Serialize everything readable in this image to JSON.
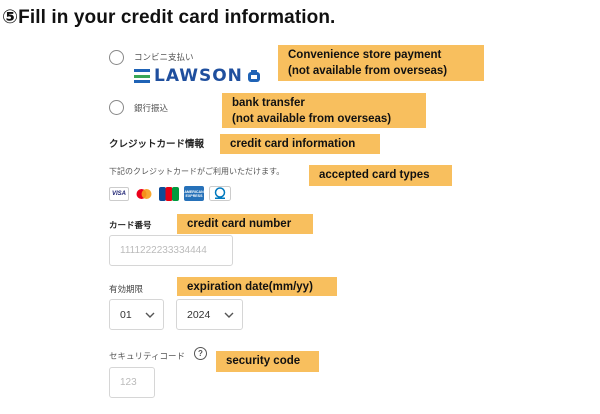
{
  "title": "⑤Fill in your credit card information.",
  "payment_options": {
    "convenience": {
      "label": "コンビニ支払い",
      "logo_text": "LAWSON"
    },
    "bank": {
      "label": "銀行振込"
    }
  },
  "credit_card": {
    "section_label": "クレジットカード情報",
    "accepted_note": "下記のクレジットカードがご利用いただけます。",
    "card_brands": [
      "VISA",
      "Mastercard",
      "JCB",
      "AMERICAN EXPRESS",
      "Diners Club"
    ],
    "number_label": "カード番号",
    "number_placeholder": "1111222233334444",
    "expiry_label": "有効期限",
    "expiry_month": "01",
    "expiry_year": "2024",
    "security_label": "セキュリティコード",
    "security_placeholder": "123"
  },
  "callouts": {
    "convenience": [
      "Convenience store payment",
      "(not available from overseas)"
    ],
    "bank": [
      "bank transfer",
      "(not available from overseas)"
    ],
    "card_info": "credit card information",
    "accepted": "accepted card types",
    "number": "credit card number",
    "expiry": "expiration date(mm/yy)",
    "security": "security code"
  },
  "colors": {
    "callout": "#f8bf5e",
    "lawson_blue": "#1f4f9e"
  }
}
